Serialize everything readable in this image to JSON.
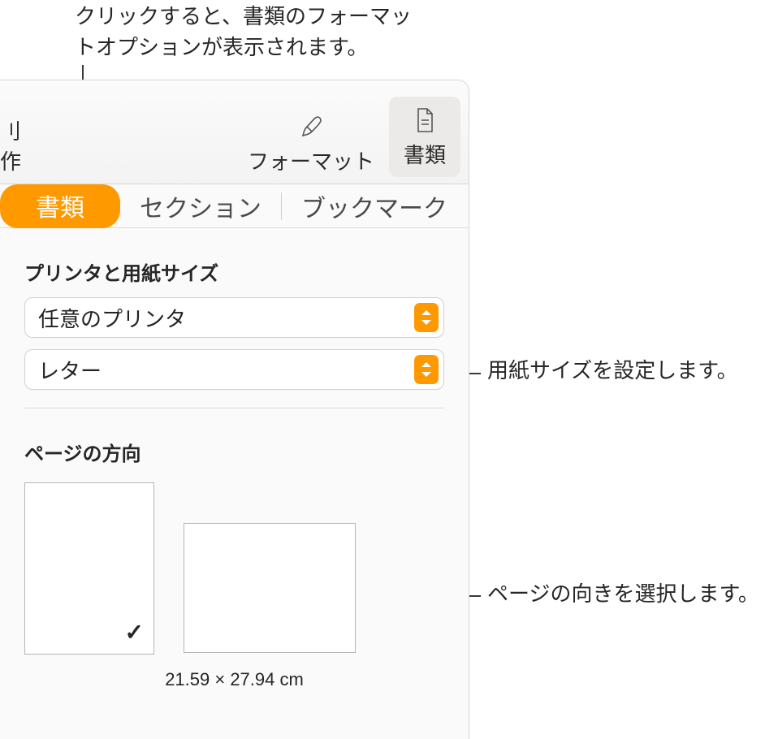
{
  "annotations": {
    "top": "クリックすると、書類のフォーマットオプションが表示されます。",
    "paper_size": "用紙サイズを設定します。",
    "orientation": "ページの向きを選択します。"
  },
  "toolbar": {
    "left_fragment": "刂作",
    "format_label": "フォーマット",
    "document_label": "書類"
  },
  "subtabs": {
    "document": "書類",
    "section": "セクション",
    "bookmark": "ブックマーク"
  },
  "printer_section": {
    "title": "プリンタと用紙サイズ",
    "printer_value": "任意のプリンタ",
    "paper_value": "レター"
  },
  "orientation_section": {
    "title": "ページの方向",
    "dimensions": "21.59 × 27.94 cm",
    "checkmark": "✓"
  }
}
